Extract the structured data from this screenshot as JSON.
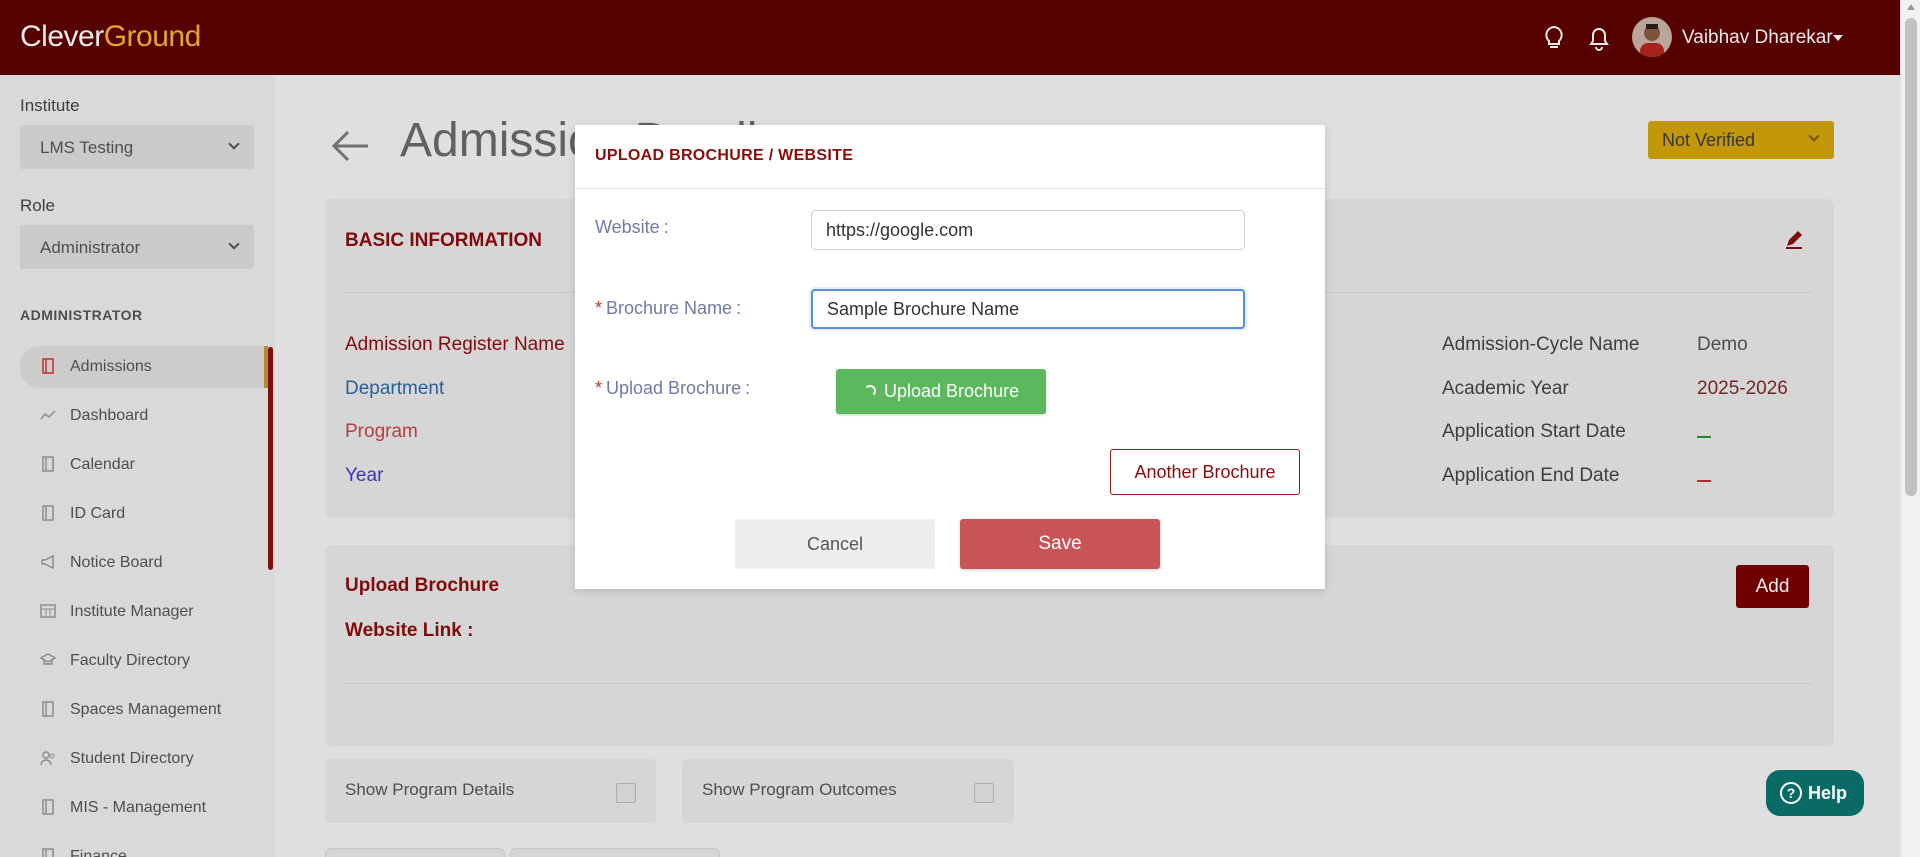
{
  "app": {
    "logo_part1": "Clever",
    "logo_part2": "Ground",
    "user_name": "Vaibhav Dharekar",
    "icons": [
      "lightbulb-icon",
      "bell-icon",
      "avatar"
    ]
  },
  "sidebar": {
    "institute_label": "Institute",
    "institute_value": "LMS Testing",
    "role_label": "Role",
    "role_value": "Administrator",
    "section_title": "ADMINISTRATOR",
    "items": [
      {
        "label": "Admissions",
        "icon": "document-icon",
        "active": true
      },
      {
        "label": "Dashboard",
        "icon": "chart-line-icon"
      },
      {
        "label": "Calendar",
        "icon": "document-icon"
      },
      {
        "label": "ID Card",
        "icon": "document-icon"
      },
      {
        "label": "Notice Board",
        "icon": "megaphone-icon"
      },
      {
        "label": "Institute Manager",
        "icon": "calendar-grid-icon"
      },
      {
        "label": "Faculty Directory",
        "icon": "graduation-icon"
      },
      {
        "label": "Spaces Management",
        "icon": "document-icon"
      },
      {
        "label": "Student Directory",
        "icon": "users-icon"
      },
      {
        "label": "MIS - Management",
        "icon": "document-icon"
      },
      {
        "label": "Finance",
        "icon": "document-icon"
      }
    ]
  },
  "page": {
    "title": "Admission Details",
    "status": "Not Verified",
    "basic_info": {
      "title": "BASIC INFORMATION",
      "left_labels": [
        "Admission Register Name",
        "Department",
        "Program",
        "Year"
      ],
      "right_labels": [
        "Admission-Cycle Name",
        "Academic Year",
        "Application Start Date",
        "Application End Date"
      ],
      "right_values": [
        "Demo",
        "2025-2026",
        "",
        ""
      ]
    },
    "brochure_card": {
      "title": "Upload Brochure",
      "website_link_label": "Website Link :",
      "add_label": "Add"
    },
    "checks": {
      "program_details": "Show Program Details",
      "program_outcomes": "Show Program Outcomes"
    },
    "help_label": "Help"
  },
  "modal": {
    "title": "UPLOAD BROCHURE / WEBSITE",
    "website_label": "Website",
    "website_value": "https://google.com",
    "brochure_name_label": "Brochure Name",
    "brochure_name_value": "Sample Brochure Name",
    "upload_label": "Upload Brochure",
    "upload_button": "Upload Brochure",
    "another_button": "Another Brochure",
    "cancel_button": "Cancel",
    "save_button": "Save",
    "required_mark": "*",
    "colon": ":"
  },
  "colors": {
    "topbar": "#5f0000",
    "brand_yellow": "#f3b531",
    "primary_red": "#8a0d0d",
    "save_red": "#c85555",
    "upload_green": "#5cb85c",
    "status_yellow": "#d3a40a",
    "help_teal": "#0a6b66"
  }
}
